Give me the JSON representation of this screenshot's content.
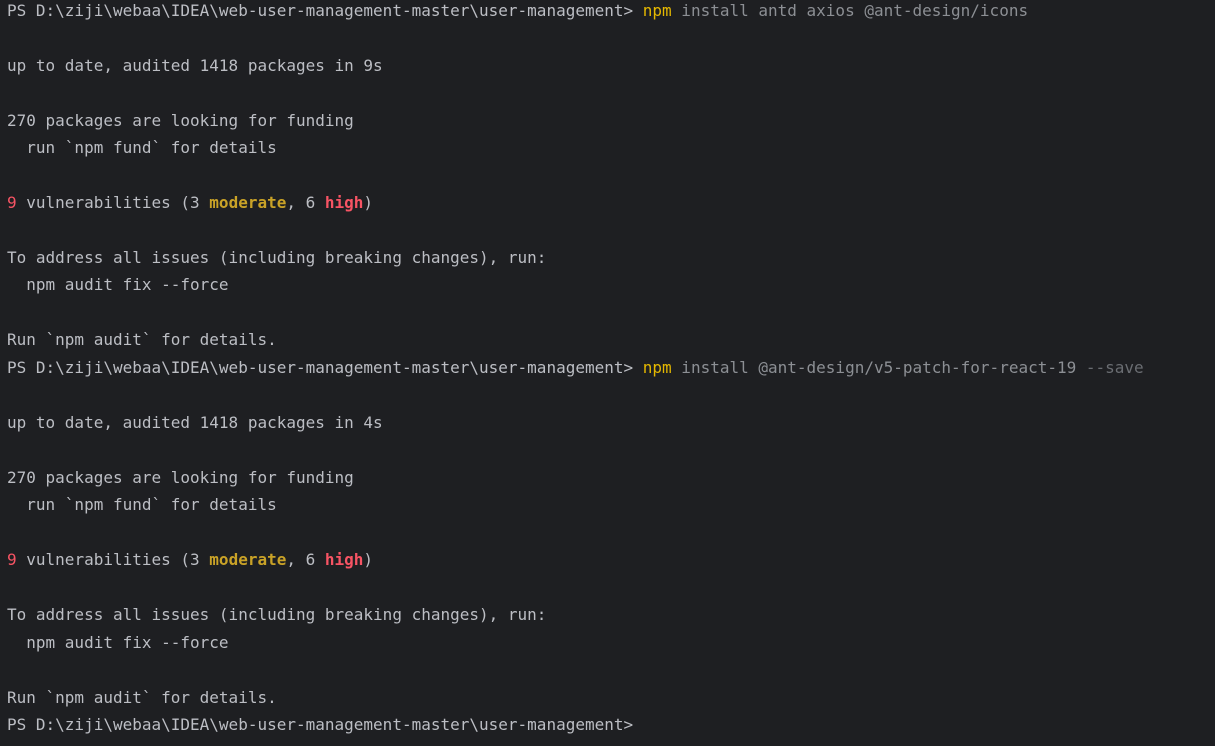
{
  "session": {
    "prompt": "PS D:\\ziji\\webaa\\IDEA\\web-user-management-master\\user-management> "
  },
  "run1": {
    "cmd": "npm",
    "args": " install antd axios @ant-design/icons",
    "audit": "up to date, audited 1418 packages in 9s",
    "funding": "270 packages are looking for funding",
    "fund_hint": "  run `npm fund` for details",
    "vuln_count": "9",
    "vuln_text1": " vulnerabilities (3 ",
    "moderate": "moderate",
    "vuln_text2": ", 6 ",
    "high": "high",
    "vuln_text3": ")",
    "address": "To address all issues (including breaking changes), run:",
    "fix_cmd": "  npm audit fix --force",
    "audit_hint": "Run `npm audit` for details."
  },
  "run2": {
    "cmd": "npm",
    "args": " install @ant-design/v5-patch-for-react-19 ",
    "flag": "--save",
    "audit": "up to date, audited 1418 packages in 4s",
    "funding": "270 packages are looking for funding",
    "fund_hint": "  run `npm fund` for details",
    "vuln_count": "9",
    "vuln_text1": " vulnerabilities (3 ",
    "moderate": "moderate",
    "vuln_text2": ", 6 ",
    "high": "high",
    "vuln_text3": ")",
    "address": "To address all issues (including breaking changes), run:",
    "fix_cmd": "  npm audit fix --force",
    "audit_hint": "Run `npm audit` for details."
  },
  "colors": {
    "background": "#1e1f22",
    "text": "#bcbec4",
    "command": "#e5b800",
    "argument": "#8c8f94",
    "flag": "#6a6d72",
    "error_red": "#f75464",
    "moderate_yellow": "#c9a227"
  }
}
